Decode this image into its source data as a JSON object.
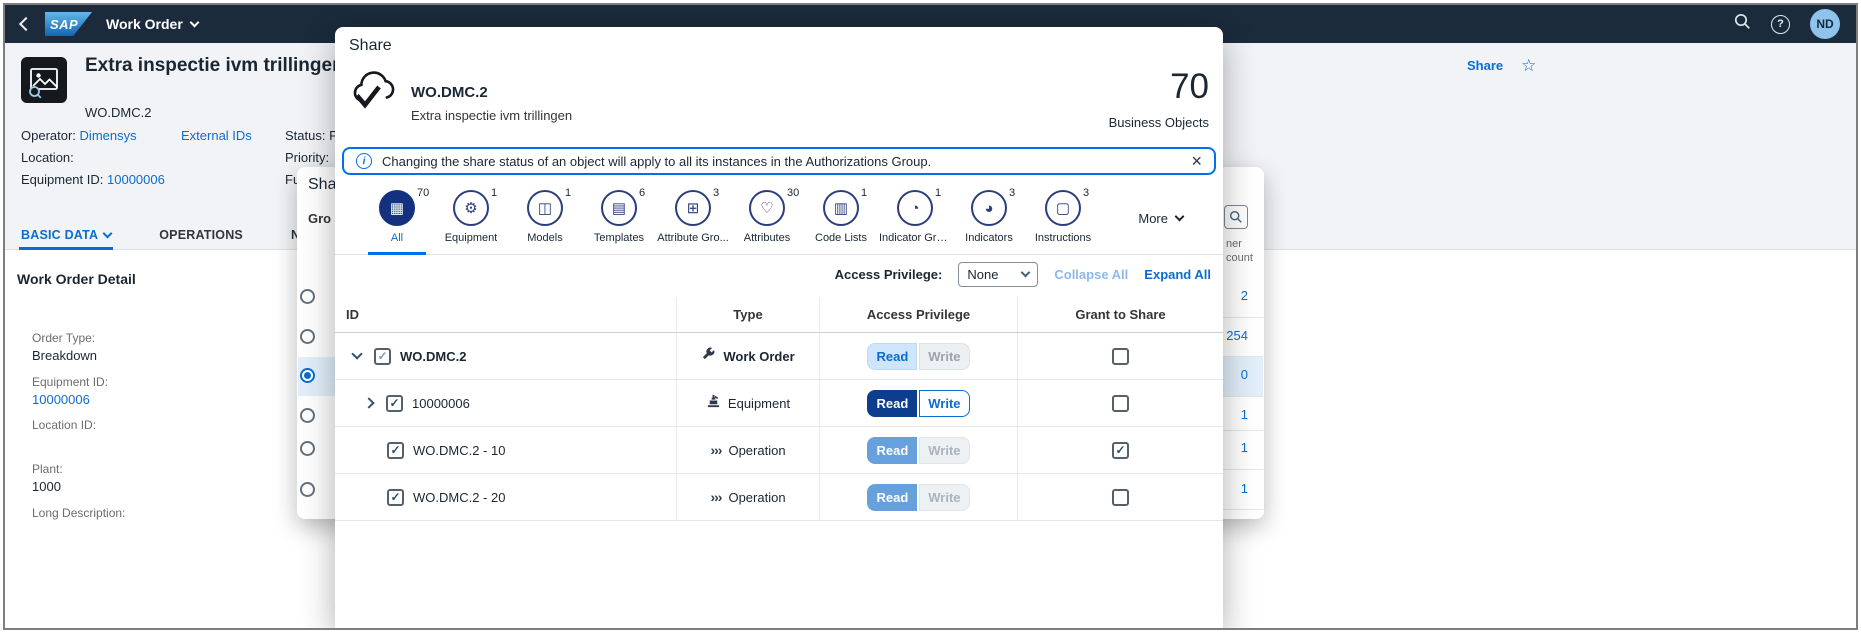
{
  "shell": {
    "logo_text": "SAP",
    "app_title": "Work Order",
    "avatar_initials": "ND"
  },
  "icons": {
    "star": "☆",
    "close": "×",
    "info": "i",
    "help": "?",
    "check": "✓",
    "operation": "›››"
  },
  "page": {
    "title": "Extra inspectie ivm trillingen",
    "subtitle": "WO.DMC.2",
    "header_fields": {
      "operator_label": "Operator:",
      "operator_value": "Dimensys",
      "external_ids_label": "External IDs",
      "status_label": "Status:",
      "status_value": "P",
      "location_label": "Location:",
      "priority_label": "Priority:",
      "equipment_label": "Equipment ID:",
      "equipment_value": "10000006",
      "function_label": "Fu"
    },
    "actions": {
      "share_label": "Share"
    },
    "tabs": [
      {
        "label": "BASIC DATA"
      },
      {
        "label": "OPERATIONS"
      },
      {
        "label": "NOTIFICATION"
      }
    ],
    "detail": {
      "heading": "Work Order Detail",
      "fields": [
        {
          "label": "Order Type:",
          "value": "Breakdown"
        },
        {
          "label": "Equipment ID:",
          "value": "10000006"
        },
        {
          "label": "Location ID:",
          "value": ""
        },
        {
          "label": "Plant:",
          "value": "1000"
        },
        {
          "label": "Long Description:",
          "value": ""
        }
      ]
    }
  },
  "back_dialog": {
    "title_fragment": "Sha",
    "tab_fragment": "Gro",
    "column_header_line1": "ner",
    "column_header_line2": "count",
    "counts": [
      "2",
      "254",
      "0",
      "1",
      "1",
      "1"
    ]
  },
  "share_dialog": {
    "title": "Share",
    "object_id": "WO.DMC.2",
    "object_description": "Extra inspectie ivm trillingen",
    "total_count": "70",
    "total_label": "Business Objects",
    "info_message": "Changing the share status of an object will apply to all its instances in the Authorizations Group.",
    "icon_tabs": [
      {
        "label": "All",
        "count": "70",
        "glyph": "▦"
      },
      {
        "label": "Equipment",
        "count": "1",
        "glyph": "⚙"
      },
      {
        "label": "Models",
        "count": "1",
        "glyph": "◫"
      },
      {
        "label": "Templates",
        "count": "6",
        "glyph": "▤"
      },
      {
        "label": "Attribute Gro...",
        "count": "3",
        "glyph": "⊞"
      },
      {
        "label": "Attributes",
        "count": "30",
        "glyph": "♡"
      },
      {
        "label": "Code Lists",
        "count": "1",
        "glyph": "▥"
      },
      {
        "label": "Indicator Gro...",
        "count": "1",
        "glyph": "◔"
      },
      {
        "label": "Indicators",
        "count": "3",
        "glyph": "◕"
      },
      {
        "label": "Instructions",
        "count": "3",
        "glyph": "▢"
      }
    ],
    "more_label": "More",
    "toolbar": {
      "access_privilege_label": "Access Privilege:",
      "selected_privilege": "None",
      "collapse_all_label": "Collapse All",
      "expand_all_label": "Expand All"
    },
    "table": {
      "columns": [
        "ID",
        "Type",
        "Access Privilege",
        "Grant to Share"
      ],
      "read_label": "Read",
      "write_label": "Write",
      "rows": [
        {
          "id": "WO.DMC.2",
          "type": "Work Order"
        },
        {
          "id": "10000006",
          "type": "Equipment"
        },
        {
          "id": "WO.DMC.2 - 10",
          "type": "Operation"
        },
        {
          "id": "WO.DMC.2 - 20",
          "type": "Operation"
        }
      ]
    }
  }
}
